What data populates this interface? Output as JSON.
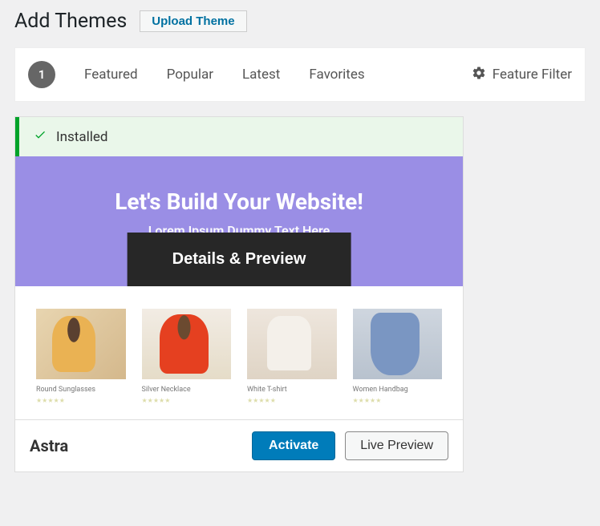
{
  "header": {
    "title": "Add Themes",
    "upload_label": "Upload Theme"
  },
  "filter": {
    "count": "1",
    "featured": "Featured",
    "popular": "Popular",
    "latest": "Latest",
    "favorites": "Favorites",
    "feature_filter": "Feature Filter"
  },
  "theme": {
    "installed_label": "Installed",
    "hero_title": "Let's Build Your Website!",
    "hero_sub": "Lorem Ipsum Dummy Text Here",
    "details_label": "Details & Preview",
    "products": [
      {
        "name": "Round Sunglasses"
      },
      {
        "name": "Silver Necklace"
      },
      {
        "name": "White T-shirt"
      },
      {
        "name": "Women Handbag"
      }
    ],
    "name": "Astra",
    "activate": "Activate",
    "live_preview": "Live Preview"
  }
}
